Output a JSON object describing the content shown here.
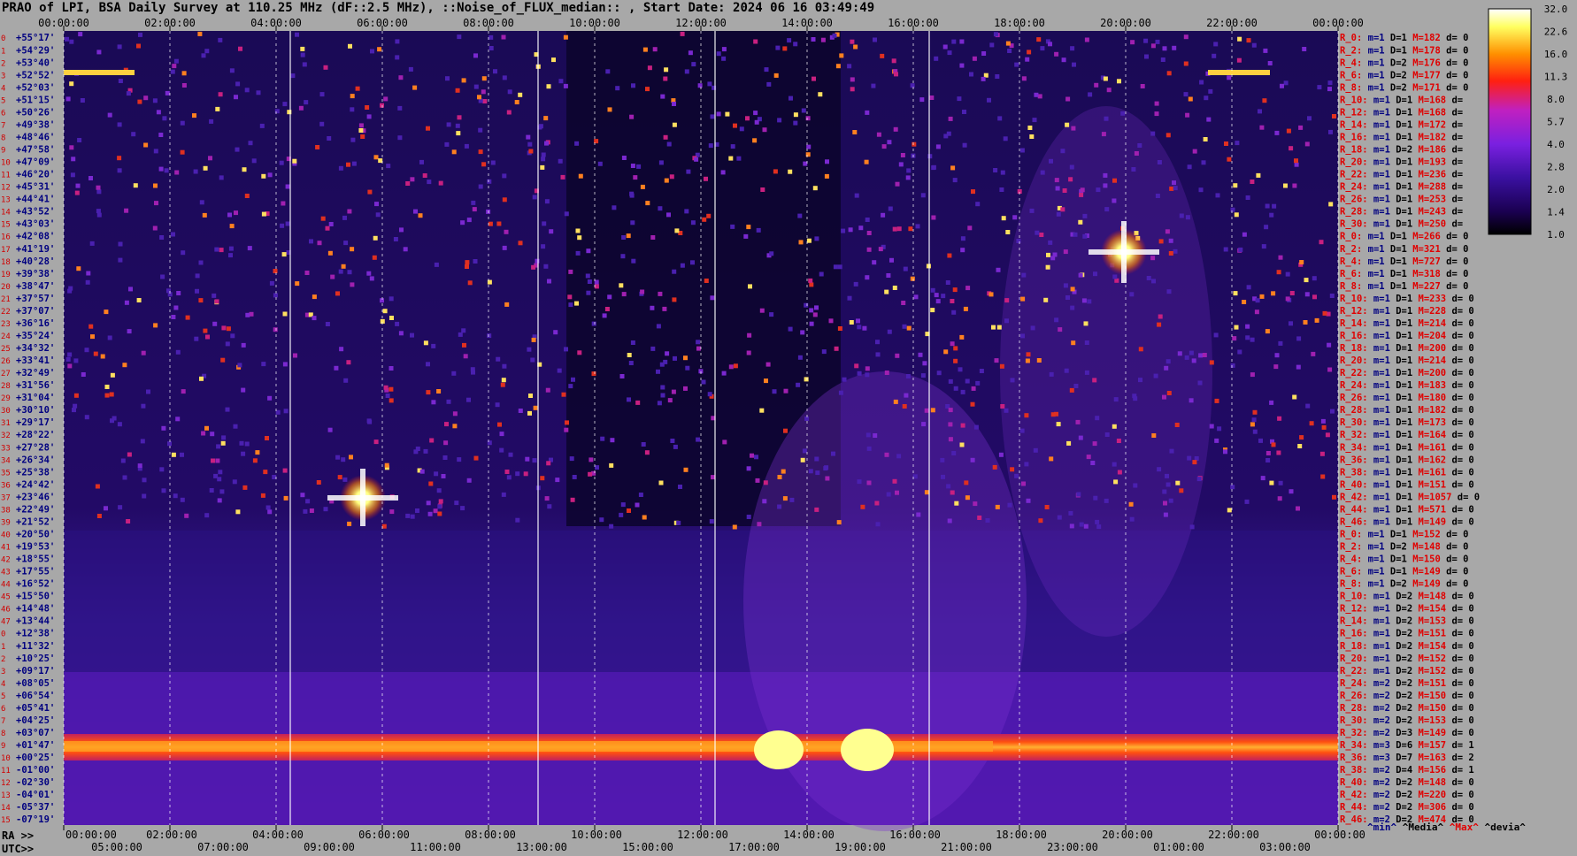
{
  "title": "PRAO of LPI, BSA Daily Survey at 110.25 MHz (dF::2.5 MHz), ::Noise_of_FLUX_median:: , Start Date: 2024 06 16 03:49:49",
  "footer": {
    "ra_prefix": "RA >>",
    "utc_prefix": "UTC>>"
  },
  "legend_keys": [
    {
      "text": "^min^",
      "color": "#000080"
    },
    {
      "text": "^Media^",
      "color": "#000000"
    },
    {
      "text": "^Max^",
      "color": "#e00000"
    },
    {
      "text": "^devia^",
      "color": "#000000"
    }
  ],
  "colors": {
    "background": "#a8a8a8",
    "colormap": [
      "#000000",
      "#1a0050",
      "#3a10a0",
      "#7a20e0",
      "#c020c0",
      "#ff2010",
      "#ff9000",
      "#ffff60",
      "#ffffff"
    ]
  },
  "chart_data": {
    "type": "heatmap",
    "top_axis_ticks": [
      "00:00:00",
      "02:00:00",
      "04:00:00",
      "06:00:00",
      "08:00:00",
      "10:00:00",
      "12:00:00",
      "14:00:00",
      "16:00:00",
      "18:00:00",
      "20:00:00",
      "22:00:00",
      "00:00:00"
    ],
    "ra_axis_ticks": [
      "00:00:00",
      "02:00:00",
      "04:00:00",
      "06:00:00",
      "08:00:00",
      "10:00:00",
      "12:00:00",
      "14:00:00",
      "16:00:00",
      "18:00:00",
      "20:00:00",
      "22:00:00",
      "00:00:00"
    ],
    "utc_axis_ticks": [
      "05:00:00",
      "07:00:00",
      "09:00:00",
      "11:00:00",
      "13:00:00",
      "15:00:00",
      "17:00:00",
      "19:00:00",
      "21:00:00",
      "23:00:00",
      "01:00:00",
      "03:00:00"
    ],
    "colorbar_ticks": [
      "32.0",
      "22.6",
      "16.0",
      "11.3",
      "8.0",
      "5.7",
      "4.0",
      "2.8",
      "2.0",
      "1.4",
      "1.0"
    ],
    "declinations": [
      "+55°17'",
      "+54°29'",
      "+53°40'",
      "+52°52'",
      "+52°03'",
      "+51°15'",
      "+50°26'",
      "+49°38'",
      "+48°46'",
      "+47°58'",
      "+47°09'",
      "+46°20'",
      "+45°31'",
      "+44°41'",
      "+43°52'",
      "+43°03'",
      "+42°08'",
      "+41°19'",
      "+40°28'",
      "+39°38'",
      "+38°47'",
      "+37°57'",
      "+37°07'",
      "+36°16'",
      "+35°24'",
      "+34°32'",
      "+33°41'",
      "+32°49'",
      "+31°56'",
      "+31°04'",
      "+30°10'",
      "+29°17'",
      "+28°22'",
      "+27°28'",
      "+26°34'",
      "+25°38'",
      "+24°42'",
      "+23°46'",
      "+22°49'",
      "+21°52'",
      "+20°50'",
      "+19°53'",
      "+18°55'",
      "+17°55'",
      "+16°52'",
      "+15°50'",
      "+14°48'",
      "+13°44'",
      "+12°38'",
      "+11°32'",
      "+10°25'",
      "+09°17'",
      "+08°05'",
      "+06°54'",
      "+05°41'",
      "+04°25'",
      "+03°07'",
      "+01°47'",
      "+00°25'",
      "-01°00'",
      "-02°30'",
      "-04°01'",
      "-05°37'",
      "-07°19'"
    ],
    "right_labels": [
      {
        "r": "R_0:",
        "m": "m=1",
        "d": "D=1",
        "mx": "M=182",
        "dv": "d= 0"
      },
      {
        "r": "R_2:",
        "m": "m=1",
        "d": "D=1",
        "mx": "M=178",
        "dv": "d= 0"
      },
      {
        "r": "R_4:",
        "m": "m=1",
        "d": "D=2",
        "mx": "M=176",
        "dv": "d= 0"
      },
      {
        "r": "R_6:",
        "m": "m=1",
        "d": "D=2",
        "mx": "M=177",
        "dv": "d= 0"
      },
      {
        "r": "R_8:",
        "m": "m=1",
        "d": "D=2",
        "mx": "M=171",
        "dv": "d= 0"
      },
      {
        "r": "R_10:",
        "m": "m=1",
        "d": "D=1",
        "mx": "M=168",
        "dv": "d="
      },
      {
        "r": "R_12:",
        "m": "m=1",
        "d": "D=1",
        "mx": "M=168",
        "dv": "d="
      },
      {
        "r": "R_14:",
        "m": "m=1",
        "d": "D=1",
        "mx": "M=172",
        "dv": "d="
      },
      {
        "r": "R_16:",
        "m": "m=1",
        "d": "D=1",
        "mx": "M=182",
        "dv": "d="
      },
      {
        "r": "R_18:",
        "m": "m=1",
        "d": "D=2",
        "mx": "M=186",
        "dv": "d="
      },
      {
        "r": "R_20:",
        "m": "m=1",
        "d": "D=1",
        "mx": "M=193",
        "dv": "d="
      },
      {
        "r": "R_22:",
        "m": "m=1",
        "d": "D=1",
        "mx": "M=236",
        "dv": "d="
      },
      {
        "r": "R_24:",
        "m": "m=1",
        "d": "D=1",
        "mx": "M=288",
        "dv": "d="
      },
      {
        "r": "R_26:",
        "m": "m=1",
        "d": "D=1",
        "mx": "M=253",
        "dv": "d="
      },
      {
        "r": "R_28:",
        "m": "m=1",
        "d": "D=1",
        "mx": "M=243",
        "dv": "d="
      },
      {
        "r": "R_30:",
        "m": "m=1",
        "d": "D=1",
        "mx": "M=250",
        "dv": "d="
      },
      {
        "r": "R_0:",
        "m": "m=1",
        "d": "D=1",
        "mx": "M=266",
        "dv": "d= 0"
      },
      {
        "r": "R_2:",
        "m": "m=1",
        "d": "D=1",
        "mx": "M=321",
        "dv": "d= 0"
      },
      {
        "r": "R_4:",
        "m": "m=1",
        "d": "D=1",
        "mx": "M=727",
        "dv": "d= 0"
      },
      {
        "r": "R_6:",
        "m": "m=1",
        "d": "D=1",
        "mx": "M=318",
        "dv": "d= 0"
      },
      {
        "r": "R_8:",
        "m": "m=1",
        "d": "D=1",
        "mx": "M=227",
        "dv": "d= 0"
      },
      {
        "r": "R_10:",
        "m": "m=1",
        "d": "D=1",
        "mx": "M=233",
        "dv": "d= 0"
      },
      {
        "r": "R_12:",
        "m": "m=1",
        "d": "D=1",
        "mx": "M=228",
        "dv": "d= 0"
      },
      {
        "r": "R_14:",
        "m": "m=1",
        "d": "D=1",
        "mx": "M=214",
        "dv": "d= 0"
      },
      {
        "r": "R_16:",
        "m": "m=1",
        "d": "D=1",
        "mx": "M=204",
        "dv": "d= 0"
      },
      {
        "r": "R_18:",
        "m": "m=1",
        "d": "D=1",
        "mx": "M=200",
        "dv": "d= 0"
      },
      {
        "r": "R_20:",
        "m": "m=1",
        "d": "D=1",
        "mx": "M=214",
        "dv": "d= 0"
      },
      {
        "r": "R_22:",
        "m": "m=1",
        "d": "D=1",
        "mx": "M=200",
        "dv": "d= 0"
      },
      {
        "r": "R_24:",
        "m": "m=1",
        "d": "D=1",
        "mx": "M=183",
        "dv": "d= 0"
      },
      {
        "r": "R_26:",
        "m": "m=1",
        "d": "D=1",
        "mx": "M=180",
        "dv": "d= 0"
      },
      {
        "r": "R_28:",
        "m": "m=1",
        "d": "D=1",
        "mx": "M=182",
        "dv": "d= 0"
      },
      {
        "r": "R_30:",
        "m": "m=1",
        "d": "D=1",
        "mx": "M=173",
        "dv": "d= 0"
      },
      {
        "r": "R_32:",
        "m": "m=1",
        "d": "D=1",
        "mx": "M=164",
        "dv": "d= 0"
      },
      {
        "r": "R_34:",
        "m": "m=1",
        "d": "D=1",
        "mx": "M=161",
        "dv": "d= 0"
      },
      {
        "r": "R_36:",
        "m": "m=1",
        "d": "D=1",
        "mx": "M=162",
        "dv": "d= 0"
      },
      {
        "r": "R_38:",
        "m": "m=1",
        "d": "D=1",
        "mx": "M=161",
        "dv": "d= 0"
      },
      {
        "r": "R_40:",
        "m": "m=1",
        "d": "D=1",
        "mx": "M=151",
        "dv": "d= 0"
      },
      {
        "r": "R_42:",
        "m": "m=1",
        "d": "D=1",
        "mx": "M=1057",
        "dv": "d= 0"
      },
      {
        "r": "R_44:",
        "m": "m=1",
        "d": "D=1",
        "mx": "M=571",
        "dv": "d= 0"
      },
      {
        "r": "R_46:",
        "m": "m=1",
        "d": "D=1",
        "mx": "M=149",
        "dv": "d= 0"
      },
      {
        "r": "R_0:",
        "m": "m=1",
        "d": "D=1",
        "mx": "M=152",
        "dv": "d= 0"
      },
      {
        "r": "R_2:",
        "m": "m=1",
        "d": "D=2",
        "mx": "M=148",
        "dv": "d= 0"
      },
      {
        "r": "R_4:",
        "m": "m=1",
        "d": "D=1",
        "mx": "M=150",
        "dv": "d= 0"
      },
      {
        "r": "R_6:",
        "m": "m=1",
        "d": "D=1",
        "mx": "M=149",
        "dv": "d= 0"
      },
      {
        "r": "R_8:",
        "m": "m=1",
        "d": "D=2",
        "mx": "M=149",
        "dv": "d= 0"
      },
      {
        "r": "R_10:",
        "m": "m=1",
        "d": "D=2",
        "mx": "M=148",
        "dv": "d= 0"
      },
      {
        "r": "R_12:",
        "m": "m=1",
        "d": "D=2",
        "mx": "M=154",
        "dv": "d= 0"
      },
      {
        "r": "R_14:",
        "m": "m=1",
        "d": "D=2",
        "mx": "M=153",
        "dv": "d= 0"
      },
      {
        "r": "R_16:",
        "m": "m=1",
        "d": "D=2",
        "mx": "M=151",
        "dv": "d= 0"
      },
      {
        "r": "R_18:",
        "m": "m=1",
        "d": "D=2",
        "mx": "M=154",
        "dv": "d= 0"
      },
      {
        "r": "R_20:",
        "m": "m=1",
        "d": "D=2",
        "mx": "M=152",
        "dv": "d= 0"
      },
      {
        "r": "R_22:",
        "m": "m=1",
        "d": "D=2",
        "mx": "M=152",
        "dv": "d= 0"
      },
      {
        "r": "R_24:",
        "m": "m=2",
        "d": "D=2",
        "mx": "M=151",
        "dv": "d= 0"
      },
      {
        "r": "R_26:",
        "m": "m=2",
        "d": "D=2",
        "mx": "M=150",
        "dv": "d= 0"
      },
      {
        "r": "R_28:",
        "m": "m=2",
        "d": "D=2",
        "mx": "M=150",
        "dv": "d= 0"
      },
      {
        "r": "R_30:",
        "m": "m=2",
        "d": "D=2",
        "mx": "M=153",
        "dv": "d= 0"
      },
      {
        "r": "R_32:",
        "m": "m=2",
        "d": "D=3",
        "mx": "M=149",
        "dv": "d= 0"
      },
      {
        "r": "R_34:",
        "m": "m=3",
        "d": "D=6",
        "mx": "M=157",
        "dv": "d= 1"
      },
      {
        "r": "R_36:",
        "m": "m=3",
        "d": "D=7",
        "mx": "M=163",
        "dv": "d= 2"
      },
      {
        "r": "R_38:",
        "m": "m=2",
        "d": "D=4",
        "mx": "M=156",
        "dv": "d= 1"
      },
      {
        "r": "R_40:",
        "m": "m=2",
        "d": "D=2",
        "mx": "M=148",
        "dv": "d= 0"
      },
      {
        "r": "R_42:",
        "m": "m=2",
        "d": "D=2",
        "mx": "M=220",
        "dv": "d= 0"
      },
      {
        "r": "R_44:",
        "m": "m=2",
        "d": "D=2",
        "mx": "M=306",
        "dv": "d= 0"
      },
      {
        "r": "R_46:",
        "m": "m=2",
        "d": "D=2",
        "mx": "M=474",
        "dv": "d= 0"
      }
    ]
  }
}
